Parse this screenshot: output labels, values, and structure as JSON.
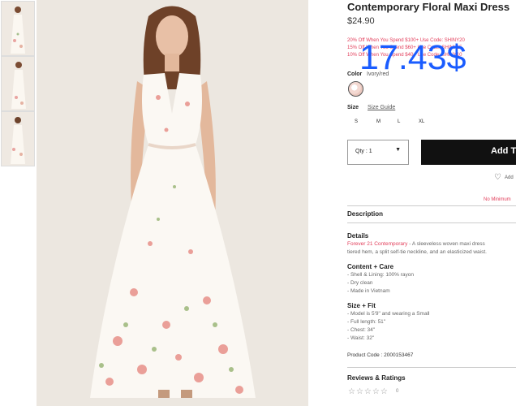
{
  "product": {
    "title": "Contemporary Floral Maxi Dress",
    "price": "$24.90",
    "promos": [
      "20% Off When You Spend $100+ Use Code: SHINY20",
      "15% Off When You Spend $60+ Use Code: SHINY15",
      "10% Off When You Spend $40+ Use Code: SHINY10"
    ],
    "overlay_price": "17.43$"
  },
  "options": {
    "color_label": "Color",
    "color_value": "Ivory/red",
    "size_label": "Size",
    "size_guide": "Size Guide",
    "sizes": [
      "S",
      "M",
      "L",
      "XL"
    ],
    "qty_label": "Qty : 1",
    "add_button": "Add T",
    "wishlist": "Add",
    "notice": "No Minimum"
  },
  "description": {
    "heading": "Description",
    "details_heading": "Details",
    "brand": "Forever 21 Contemporary",
    "details_text_1": " - A sleeveless woven maxi dress",
    "details_text_2": "tiered hem, a split self-tie neckline, and an elasticized waist.",
    "content_heading": "Content + Care",
    "content": [
      "- Shell & Lining: 100% rayon",
      "- Dry clean",
      "- Made in Vietnam"
    ],
    "size_fit_heading": "Size + Fit",
    "size_fit": [
      "- Model is 5'9\" and wearing a Small",
      "- Full length: 51\"",
      "- Chest: 34\"",
      "- Waist: 32\""
    ],
    "product_code": "Product Code : 2000153467"
  },
  "reviews": {
    "heading": "Reviews & Ratings",
    "stars": "☆☆☆☆☆",
    "count": "0"
  },
  "icons": {
    "heart": "heart-icon",
    "caret": "chevron-down-icon",
    "star": "star-icon"
  }
}
